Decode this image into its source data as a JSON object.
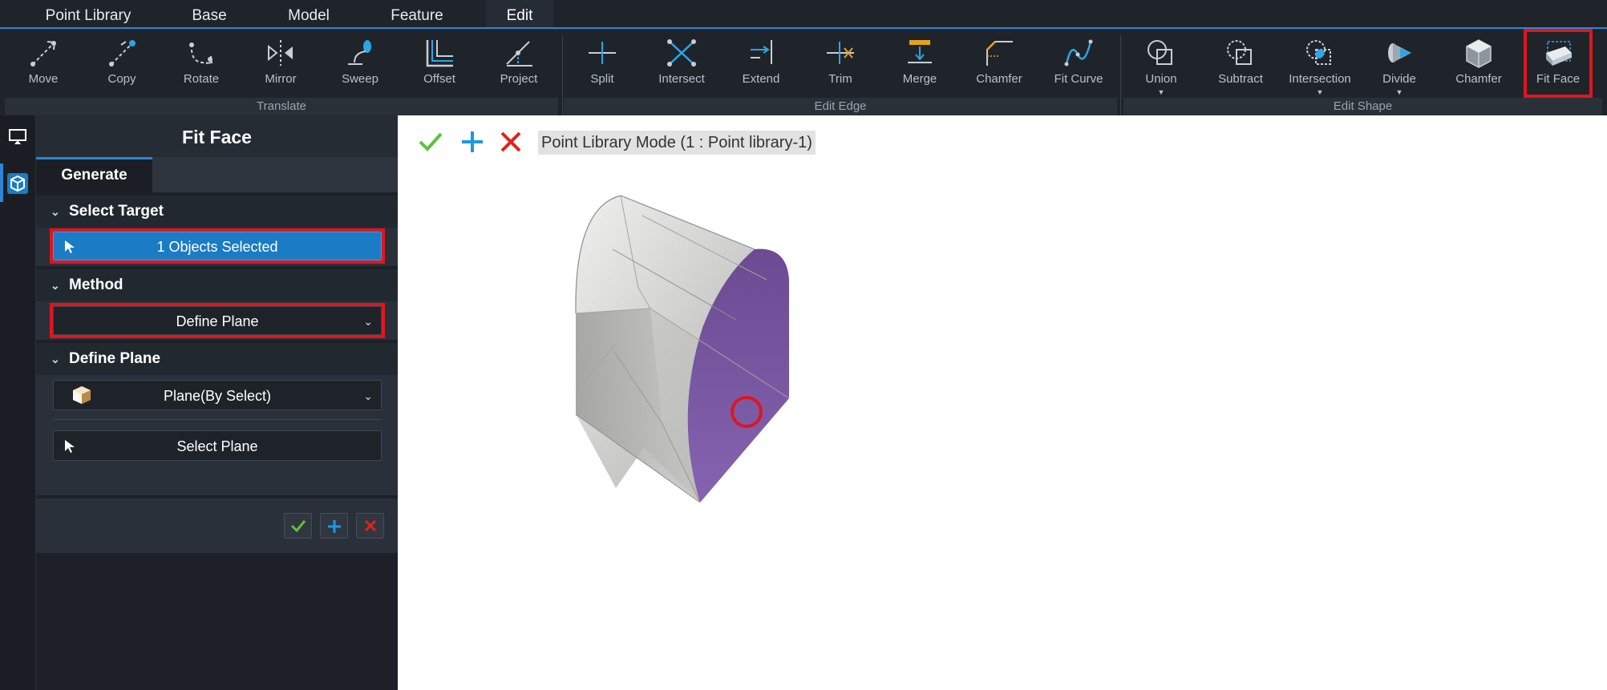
{
  "menu": {
    "tabs": [
      {
        "label": "Point Library"
      },
      {
        "label": "Base"
      },
      {
        "label": "Model"
      },
      {
        "label": "Feature"
      },
      {
        "label": "Edit",
        "active": true
      }
    ]
  },
  "ribbon": {
    "groups": [
      {
        "label": "Translate"
      },
      {
        "label": "Edit Edge"
      },
      {
        "label": "Edit Shape"
      }
    ],
    "tools": [
      {
        "label": "Move",
        "icon": "move-icon"
      },
      {
        "label": "Copy",
        "icon": "copy-icon"
      },
      {
        "label": "Rotate",
        "icon": "rotate-icon"
      },
      {
        "label": "Mirror",
        "icon": "mirror-icon"
      },
      {
        "label": "Sweep",
        "icon": "sweep-icon"
      },
      {
        "label": "Offset",
        "icon": "offset-icon"
      },
      {
        "label": "Project",
        "icon": "project-icon"
      },
      {
        "label": "Split",
        "icon": "split-icon"
      },
      {
        "label": "Intersect",
        "icon": "intersect-icon"
      },
      {
        "label": "Extend",
        "icon": "extend-icon"
      },
      {
        "label": "Trim",
        "icon": "trim-icon"
      },
      {
        "label": "Merge",
        "icon": "merge-icon"
      },
      {
        "label": "Chamfer",
        "icon": "chamfer-edge-icon"
      },
      {
        "label": "Fit Curve",
        "icon": "fit-curve-icon"
      },
      {
        "label": "Union",
        "icon": "union-icon",
        "dropdown": true
      },
      {
        "label": "Subtract",
        "icon": "subtract-icon"
      },
      {
        "label": "Intersection",
        "icon": "intersection-icon",
        "dropdown": true
      },
      {
        "label": "Divide",
        "icon": "divide-icon",
        "dropdown": true
      },
      {
        "label": "Chamfer",
        "icon": "chamfer-shape-icon"
      },
      {
        "label": "Fit Face",
        "icon": "fit-face-icon",
        "highlighted": true
      }
    ]
  },
  "panel": {
    "title": "Fit Face",
    "tab": "Generate",
    "select_target": {
      "heading": "Select Target",
      "button": "1 Objects Selected"
    },
    "method": {
      "heading": "Method",
      "value": "Define Plane"
    },
    "define_plane": {
      "heading": "Define Plane",
      "plane_option": "Plane(By Select)",
      "select_button": "Select Plane"
    }
  },
  "viewport": {
    "mode_label": "Point Library Mode (1 : Point library-1)",
    "selected_face_color": "#7b5aa6"
  },
  "colors": {
    "accent": "#2b86d6",
    "highlight": "#e0151f",
    "confirm": "#5cc238",
    "add": "#1a9ae0",
    "cancel": "#e0241a"
  }
}
